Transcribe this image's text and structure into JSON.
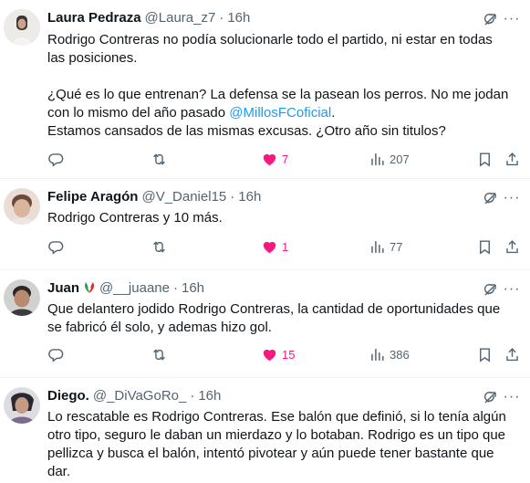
{
  "tweets": [
    {
      "name": "Laura Pedraza",
      "handle": "@Laura_z7",
      "dot": "·",
      "time": "16h",
      "lines": [
        "Rodrigo Contreras no podía solucionarle todo el partido, ni estar en todas",
        "las posiciones.",
        "",
        "¿Qué es lo que entrenan? La defensa se la pasean los perros. No me jodan",
        "con lo mismo del año pasado ",
        "Estamos cansados de las mismas excusas. ¿Otro año sin titulos?"
      ],
      "mention": "@MillosFCoficial",
      "mention_suffix": ".",
      "replies": "",
      "retweets": "",
      "likes": "7",
      "views": "207"
    },
    {
      "name": "Felipe Aragón",
      "handle": "@V_Daniel15",
      "dot": "·",
      "time": "16h",
      "lines": [
        "Rodrigo Contreras y 10 más."
      ],
      "replies": "",
      "retweets": "",
      "likes": "1",
      "views": "77"
    },
    {
      "name": "Juan",
      "handle": "@__juaane",
      "dot": "·",
      "time": "16h",
      "lines": [
        "Que delantero jodido Rodrigo Contreras, la cantidad de oportunidades que",
        "se fabricó él solo, y ademas hizo gol."
      ],
      "replies": "",
      "retweets": "",
      "likes": "15",
      "views": "386"
    },
    {
      "name": "Diego.",
      "handle": "@_DiVaGoRo_",
      "dot": "·",
      "time": "16h",
      "lines": [
        "Lo rescatable es Rodrigo Contreras. Ese balón que definió, si lo tenía algún",
        "otro tipo, seguro le daban un mierdazo y lo botaban. Rodrigo es un tipo que",
        "pellizca y busca el balón, intentó pivotear y aún puede tener bastante que",
        "dar."
      ]
    }
  ],
  "colors": {
    "accent": "#1d9bf0",
    "like_active": "#f91880",
    "muted": "#536471",
    "text": "#0f1419",
    "divider": "#eff3f4"
  },
  "icons": [
    "grok-icon",
    "reply-icon",
    "retweet-icon",
    "heart-icon",
    "views-icon",
    "bookmark-icon",
    "share-icon",
    "flag-icon"
  ]
}
